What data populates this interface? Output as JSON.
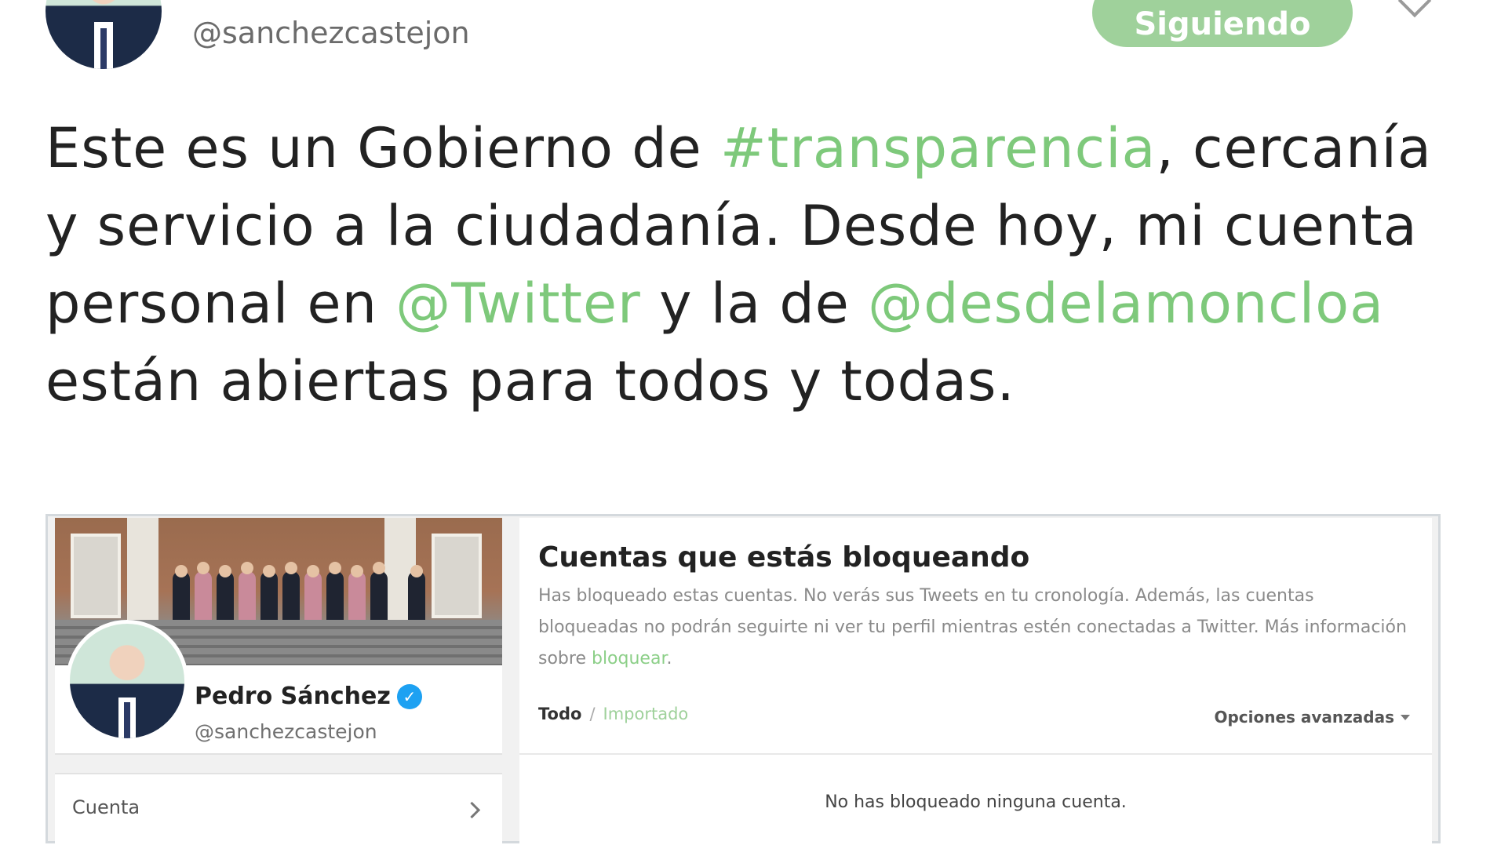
{
  "tweet": {
    "handle": "@sanchezcastejon",
    "follow_button": "Siguiendo",
    "text": {
      "part1": "Este es un Gobierno de ",
      "hashtag": "#transparencia",
      "part2": ", cercanía y servicio a la ciudadanía. Desde hoy, mi cuenta personal en ",
      "mention1": "@Twitter",
      "part3": " y la de ",
      "mention2": "@desdelamoncloa",
      "part4": " están abiertas para todos y todas."
    }
  },
  "embedded": {
    "profile": {
      "name": "Pedro Sánchez",
      "handle": "@sanchezcastejon"
    },
    "menu": {
      "item_label": "Cuenta"
    },
    "blocked": {
      "title": "Cuentas que estás bloqueando",
      "description": "Has bloqueado estas cuentas. No verás sus Tweets en tu cronología. Además, las cuentas bloqueadas no podrán seguirte ni ver tu perfil mientras estén conectadas a Twitter. Más información sobre ",
      "description_link": "bloquear",
      "description_end": ".",
      "filter_all": "Todo",
      "filter_separator": "/",
      "filter_imported": "Importado",
      "advanced_options": "Opciones avanzadas",
      "empty_message": "No has bloqueado ninguna cuenta."
    }
  },
  "colors": {
    "link_green": "#7ec97b",
    "follow_button_bg": "#9fd19b",
    "verified_blue": "#1da1f2"
  }
}
